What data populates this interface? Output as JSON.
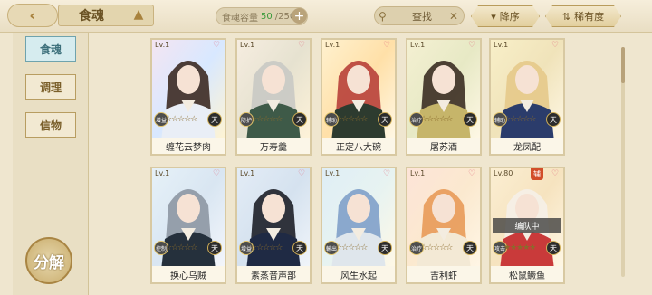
{
  "header": {
    "title": "食魂",
    "capacity_label": "食魂容量",
    "capacity_current": "50",
    "capacity_total": "/250",
    "capacity_add": "+",
    "search_label": "查找",
    "sort_desc": "降序",
    "sort_rarity": "稀有度"
  },
  "sidebar": {
    "tabs": [
      "食魂",
      "调理",
      "信物"
    ],
    "active": "食魂",
    "decompose_label": "分解"
  },
  "cards": [
    {
      "name": "缠花云梦肉",
      "level": "Lv.1",
      "badge": "增益",
      "stars": "☆☆☆☆☆",
      "rarity": "天",
      "colors": [
        "#f4e5f2",
        "#d8e8ff",
        "#fff4d2"
      ],
      "hair": "#3c2a22",
      "outfit": "#e9eef6"
    },
    {
      "name": "万寿羹",
      "level": "Lv.1",
      "badge": "防护",
      "stars": "☆☆☆☆☆",
      "rarity": "天",
      "colors": [
        "#f6ede0",
        "#e6e2d0",
        "#fff3d9"
      ],
      "hair": "#c9c9c4",
      "outfit": "#3e5a48"
    },
    {
      "name": "正定八大碗",
      "level": "Lv.1",
      "badge": "辅助",
      "stars": "☆☆☆☆☆",
      "rarity": "天",
      "colors": [
        "#fff1cf",
        "#ffe0a8",
        "#fff8e6"
      ],
      "hair": "#b8403a",
      "outfit": "#2d3b2f"
    },
    {
      "name": "屠苏酒",
      "level": "Lv.1",
      "badge": "治疗",
      "stars": "☆☆☆☆☆",
      "rarity": "天",
      "colors": [
        "#f4f0d2",
        "#e7e9c5",
        "#fff8e6"
      ],
      "hair": "#3b2e22",
      "outfit": "#c6b56a"
    },
    {
      "name": "龙凤配",
      "level": "Lv.1",
      "badge": "辅助",
      "stars": "☆☆☆☆☆",
      "rarity": "天",
      "colors": [
        "#f8efc8",
        "#f0e3ba",
        "#fff8e6"
      ],
      "hair": "#e5c98a",
      "outfit": "#2b3c6b"
    },
    {
      "name": "换心乌贼",
      "level": "Lv.1",
      "badge": "控制",
      "stars": "☆☆☆☆☆",
      "rarity": "天",
      "colors": [
        "#e6f1f8",
        "#d9e6f2",
        "#f4f6fb"
      ],
      "hair": "#8d97a3",
      "outfit": "#25303c"
    },
    {
      "name": "素蒸音声部",
      "level": "Lv.1",
      "badge": "增益",
      "stars": "☆☆☆☆☆",
      "rarity": "天",
      "colors": [
        "#e3ecf6",
        "#d5e2ef",
        "#f1f5fa"
      ],
      "hair": "#1d1f28",
      "outfit": "#1f2a44"
    },
    {
      "name": "风生水起",
      "level": "Lv.1",
      "badge": "輸出",
      "stars": "☆☆☆☆☆",
      "rarity": "天",
      "colors": [
        "#dfeef6",
        "#e7f3f1",
        "#fff8e6"
      ],
      "hair": "#7fa0c9",
      "outfit": "#dfe6ec"
    },
    {
      "name": "吉利虾",
      "level": "Lv.1",
      "badge": "治疗",
      "stars": "☆☆☆☆☆",
      "rarity": "天",
      "colors": [
        "#fde4d8",
        "#fbe9cf",
        "#fff6e6"
      ],
      "hair": "#e89a58",
      "outfit": "#f3e9d5"
    },
    {
      "name": "松鼠鳜鱼",
      "level": "Lv.80",
      "badge": "攻击",
      "stars": "★★★★★",
      "rarity": "天",
      "status": "编队中",
      "tag": "辅",
      "colors": [
        "#fbeed2",
        "#f6e3bf",
        "#fff8e6"
      ],
      "hair": "#f5f0e8",
      "outfit": "#c93a3a"
    }
  ]
}
